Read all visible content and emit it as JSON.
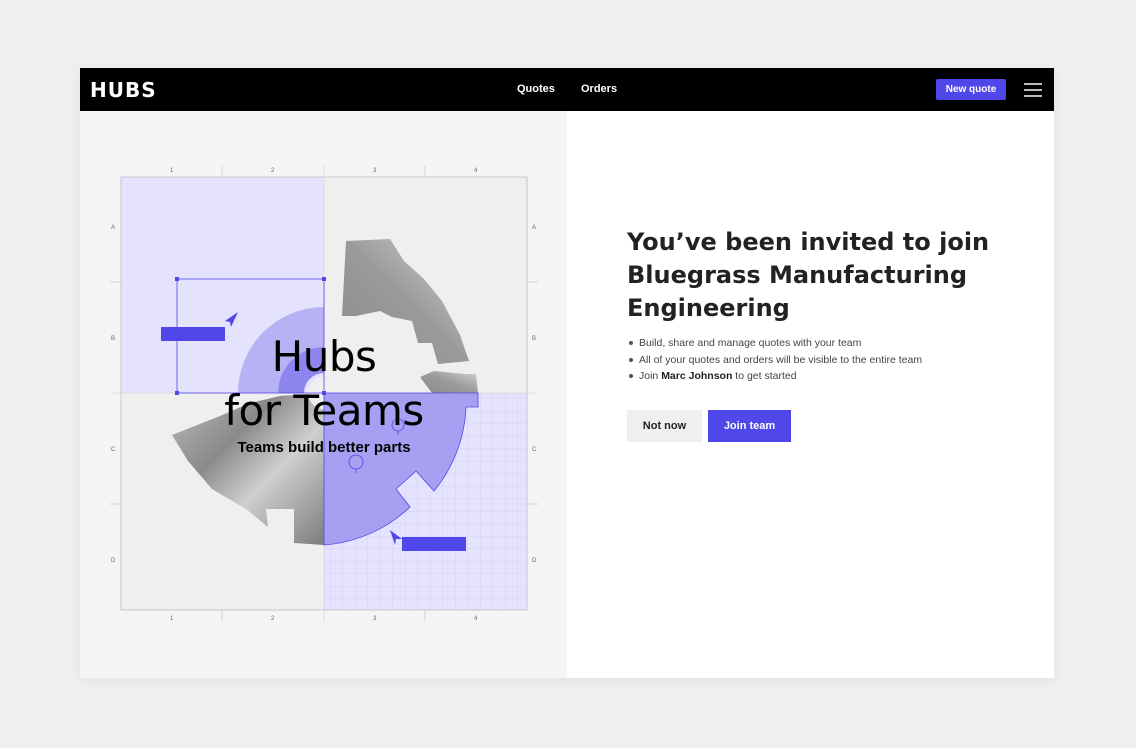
{
  "app": {
    "logo": "HUBS"
  },
  "nav": {
    "quotes": "Quotes",
    "orders": "Orders"
  },
  "header": {
    "new_quote_label": "New quote",
    "menu_icon": "hamburger-menu-icon"
  },
  "hero": {
    "title_line1": "Hubs",
    "title_line2": "for Teams",
    "subtitle": "Teams build better parts",
    "grid_columns": [
      "1",
      "2",
      "3",
      "4"
    ],
    "grid_rows": [
      "A",
      "B",
      "C",
      "D"
    ]
  },
  "invite": {
    "heading": "You’ve been invited to join Bluegrass Manufacturing Engineering",
    "bullets": [
      "Build, share and manage quotes with your team",
      "All of your quotes and orders will be visible to the entire team"
    ],
    "join_prefix": "Join ",
    "join_name": "Marc Johnson",
    "join_suffix": " to get started",
    "not_now_label": "Not now",
    "join_team_label": "Join team"
  },
  "colors": {
    "accent": "#5047ea",
    "lavender": "#e4e2fc",
    "topbar": "#000000"
  }
}
